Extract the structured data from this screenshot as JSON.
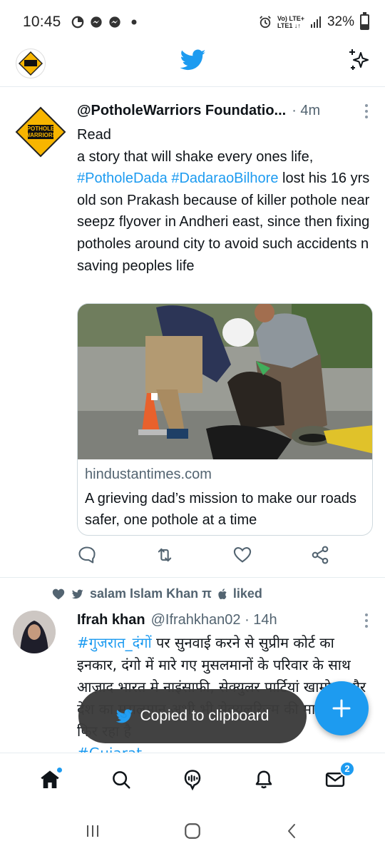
{
  "status_bar": {
    "time": "10:45",
    "network_top": "Vo) LTE+",
    "network_bottom": "LTE1 ↓↑",
    "battery": "32%",
    "battery_level": 0.32
  },
  "header": {
    "avatar_text": "POTHOLE WARRIORS"
  },
  "tweet1": {
    "display_name": "@PotholeWarriors Foundatio...",
    "meta": "· 4m",
    "avatar_text": "POTHOLE WARRIORS",
    "text_before": "Read\na story that will shake every ones life, ",
    "hashtag1": "#PotholeDada",
    "hashtag2": "#DadaraoBilhore",
    "text_after": " lost his 16 yrs old son Prakash because of killer pothole near seepz flyover in Andheri east, since then fixing potholes around city to avoid such accidents n saving peoples life",
    "card": {
      "domain": "hindustantimes.com",
      "title": "A grieving dad’s mission to make our roads safer, one pothole at a time"
    }
  },
  "tweet2": {
    "social_context": "salam Islam Khan π",
    "liked": "liked",
    "display_name": "Ifrah khan",
    "handle_meta": "@Ifrahkhan02 · 14h",
    "hashtag": "#गुजरात_दंगों",
    "text": " पर सुनवाई करने से सुप्रीम कोर्ट का इनकार, दंगो में मारे गए मुसलमानों के परिवार के साथ आज़ाद भारत मे नाइंसाफी, सेक्युलर पार्टियां खामोश और देश का मुसलमान अभी भी सेक्युलरिज्म की माला जपता फिर रहा है",
    "hashtag_bottom": "#Gujarat"
  },
  "toast": {
    "text": "Copied to clipboard"
  },
  "bottom_nav": {
    "messages_badge": "2"
  },
  "colors": {
    "accent": "#1d9bf0",
    "text": "#0f1419",
    "secondary": "#536471"
  }
}
